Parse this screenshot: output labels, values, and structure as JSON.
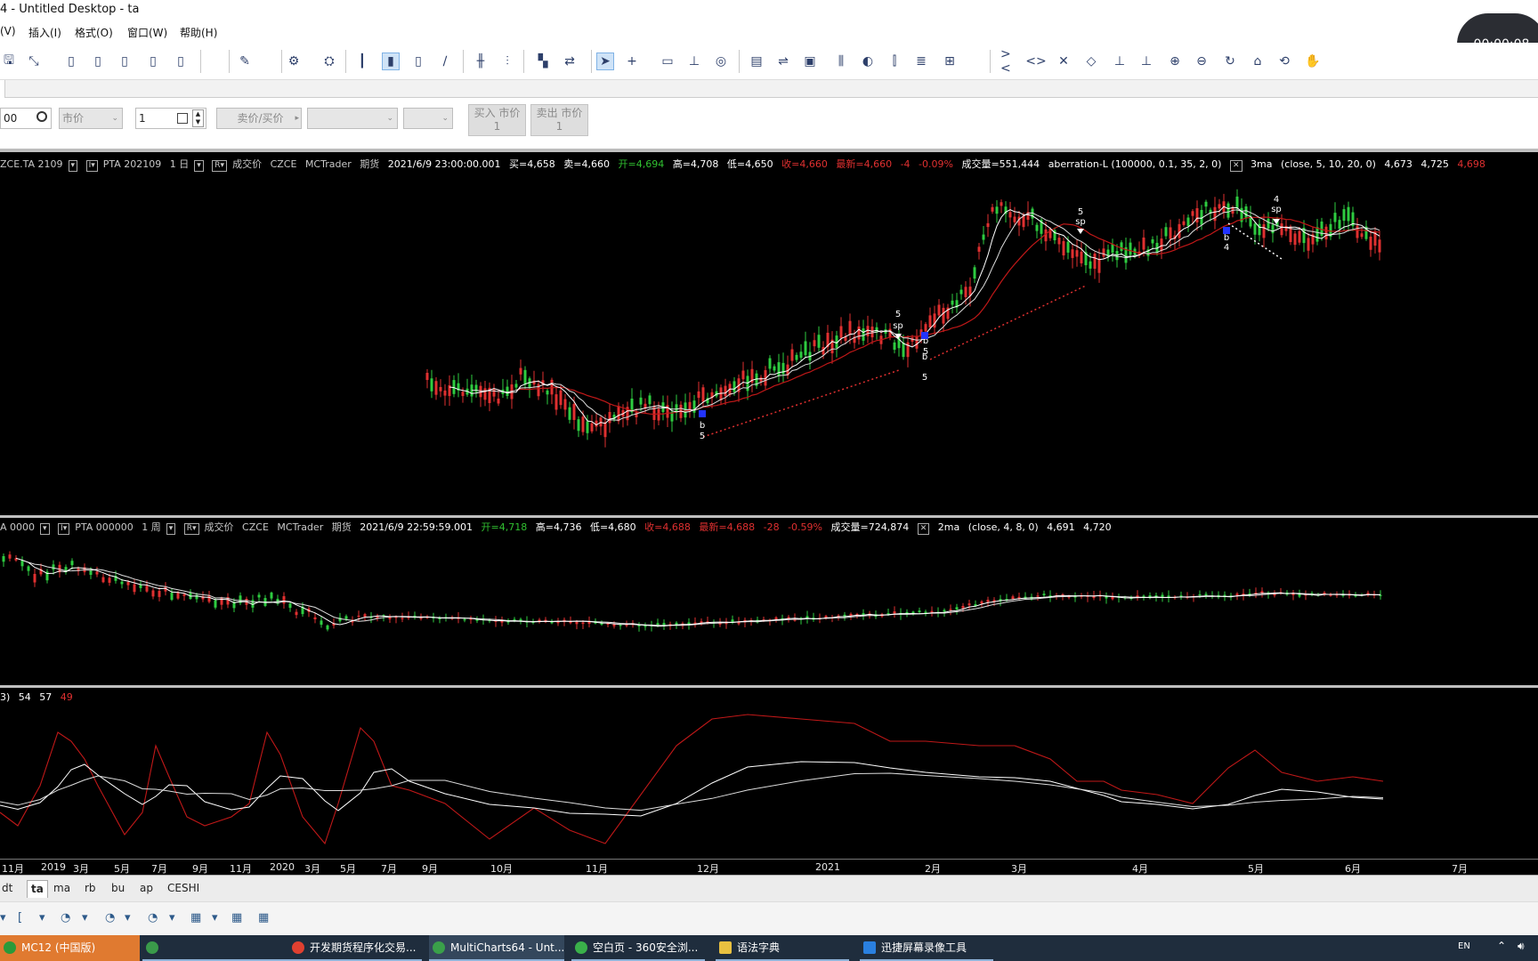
{
  "window": {
    "title": "4 - Untitled Desktop - ta"
  },
  "menu": [
    "(V)",
    "插入(I)",
    "格式(O)",
    "窗口(W)",
    "帮助(H)"
  ],
  "timer": "00:00:08",
  "toolbar_icons": [
    "save-icon",
    "chart-icon",
    "doc-icon",
    "doc-icon",
    "doc-icon",
    "doc-icon",
    "doc-icon",
    "pen-icon",
    "gear-icon",
    "window-gear-icon",
    "bar-chart-icon",
    "candle-icon",
    "candle-hollow-icon",
    "line-icon",
    "bar-icon",
    "volume-icon",
    "mix-icon",
    "arrow-icon",
    "cursor-icon",
    "crosshair-icon",
    "comment-icon",
    "hline-icon",
    "zoom-icon",
    "table-icon",
    "trade-icon",
    "ticket-icon",
    "ladder-icon",
    "dom-icon",
    "ladder2-icon",
    "ladder3-icon",
    "export-icon",
    "collapse-icon",
    "expand-icon",
    "shrink-icon",
    "scale-icon",
    "anchor-icon",
    "anchor2-icon",
    "zoom-in-icon",
    "zoom-out-icon",
    "refresh-icon",
    "lock-icon",
    "reset-icon",
    "hand-icon"
  ],
  "orderbar": {
    "symbol_value": "00",
    "order_type": "市价",
    "quantity": "1",
    "side_button": "卖价/买价",
    "buy_market": {
      "line1": "买入 市价",
      "line2": "1"
    },
    "sell_market": {
      "line1": "卖出 市价",
      "line2": "1"
    }
  },
  "pane1": {
    "symbol": "ZCE.TA 2109",
    "name": "PTA 202109",
    "period": "1 日",
    "pricetype": "成交价",
    "exchange": "CZCE",
    "feed": "MCTrader",
    "category": "期货",
    "datetime": "2021/6/9  23:00:00.001",
    "bid": "买=4,658",
    "ask": "卖=4,660",
    "open": "开=4,694",
    "high": "高=4,708",
    "low": "低=4,650",
    "close": "收=4,660",
    "last": "最新=4,660",
    "change": "-4",
    "change_pct": "-0.09%",
    "volume": "成交量=551,444",
    "strategy": "aberration-L (100000,  0.1,  35,  2,  0)",
    "study": "3ma",
    "study_params": "(close,  5,  10,  20,  0)",
    "study_v1": "4,673",
    "study_v2": "4,725",
    "study_v3": "4,698",
    "markers": [
      {
        "t": "5"
      },
      {
        "t": "sp"
      },
      {
        "t": "b"
      },
      {
        "t": "5"
      },
      {
        "t": "5"
      },
      {
        "t": "sp"
      },
      {
        "t": "b"
      },
      {
        "t": "5"
      },
      {
        "t": "b"
      },
      {
        "t": "4"
      },
      {
        "t": "4"
      },
      {
        "t": "sp"
      }
    ]
  },
  "pane2": {
    "symbol": "A 0000",
    "name": "PTA 000000",
    "period": "1 周",
    "pricetype": "成交价",
    "exchange": "CZCE",
    "feed": "MCTrader",
    "category": "期货",
    "datetime": "2021/6/9  22:59:59.001",
    "open": "开=4,718",
    "high": "高=4,736",
    "low": "低=4,680",
    "close": "收=4,688",
    "last": "最新=4,688",
    "change": "-28",
    "change_pct": "-0.59%",
    "volume": "成交量=724,874",
    "study": "2ma",
    "study_params": "(close,  4,  8,  0)",
    "study_v1": "4,691",
    "study_v2": "4,720"
  },
  "pane3": {
    "label": "3)",
    "v1": "54",
    "v2": "57",
    "v3": "49"
  },
  "xaxis": [
    "11月",
    "2019",
    "3月",
    "5月",
    "7月",
    "9月",
    "11月",
    "2020",
    "3月",
    "5月",
    "7月",
    "9月",
    "10月",
    "11月",
    "12月",
    "2021",
    "2月",
    "3月",
    "4月",
    "5月",
    "6月",
    "7月"
  ],
  "sheet_tabs": [
    "dt",
    "ta",
    "ma",
    "rb",
    "bu",
    "ap",
    "CESHI"
  ],
  "taskbar": [
    {
      "label": "MC12 (中国版)"
    },
    {
      "label": ""
    },
    {
      "label": "开发期货程序化交易..."
    },
    {
      "label": "MultiCharts64 - Unt..."
    },
    {
      "label": "空白页 - 360安全浏..."
    },
    {
      "label": "语法字典"
    },
    {
      "label": "迅捷屏幕录像工具"
    }
  ],
  "tray": {
    "lang": "EN"
  },
  "colors": {
    "up": "#e03030",
    "down": "#2ecc40",
    "ma1": "#ffffff",
    "ma2": "#dddddd",
    "ma3": "#c01818",
    "buy_marker": "#2233ff"
  }
}
